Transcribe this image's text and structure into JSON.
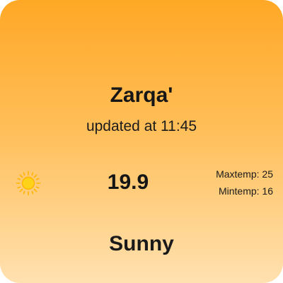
{
  "widget": {
    "city": "Zarqa'",
    "updated_text": "updated at 11:45",
    "temperature": "19.9",
    "max_temp_text": "Maxtemp: 25",
    "min_temp_text": "Mintemp: 16",
    "condition": "Sunny",
    "icon": "sun-icon",
    "colors": {
      "gradient_top": "#ffa826",
      "gradient_bottom": "#ffe1b0",
      "sun": "#ffd21a",
      "sun_rays": "#ffb400"
    }
  }
}
